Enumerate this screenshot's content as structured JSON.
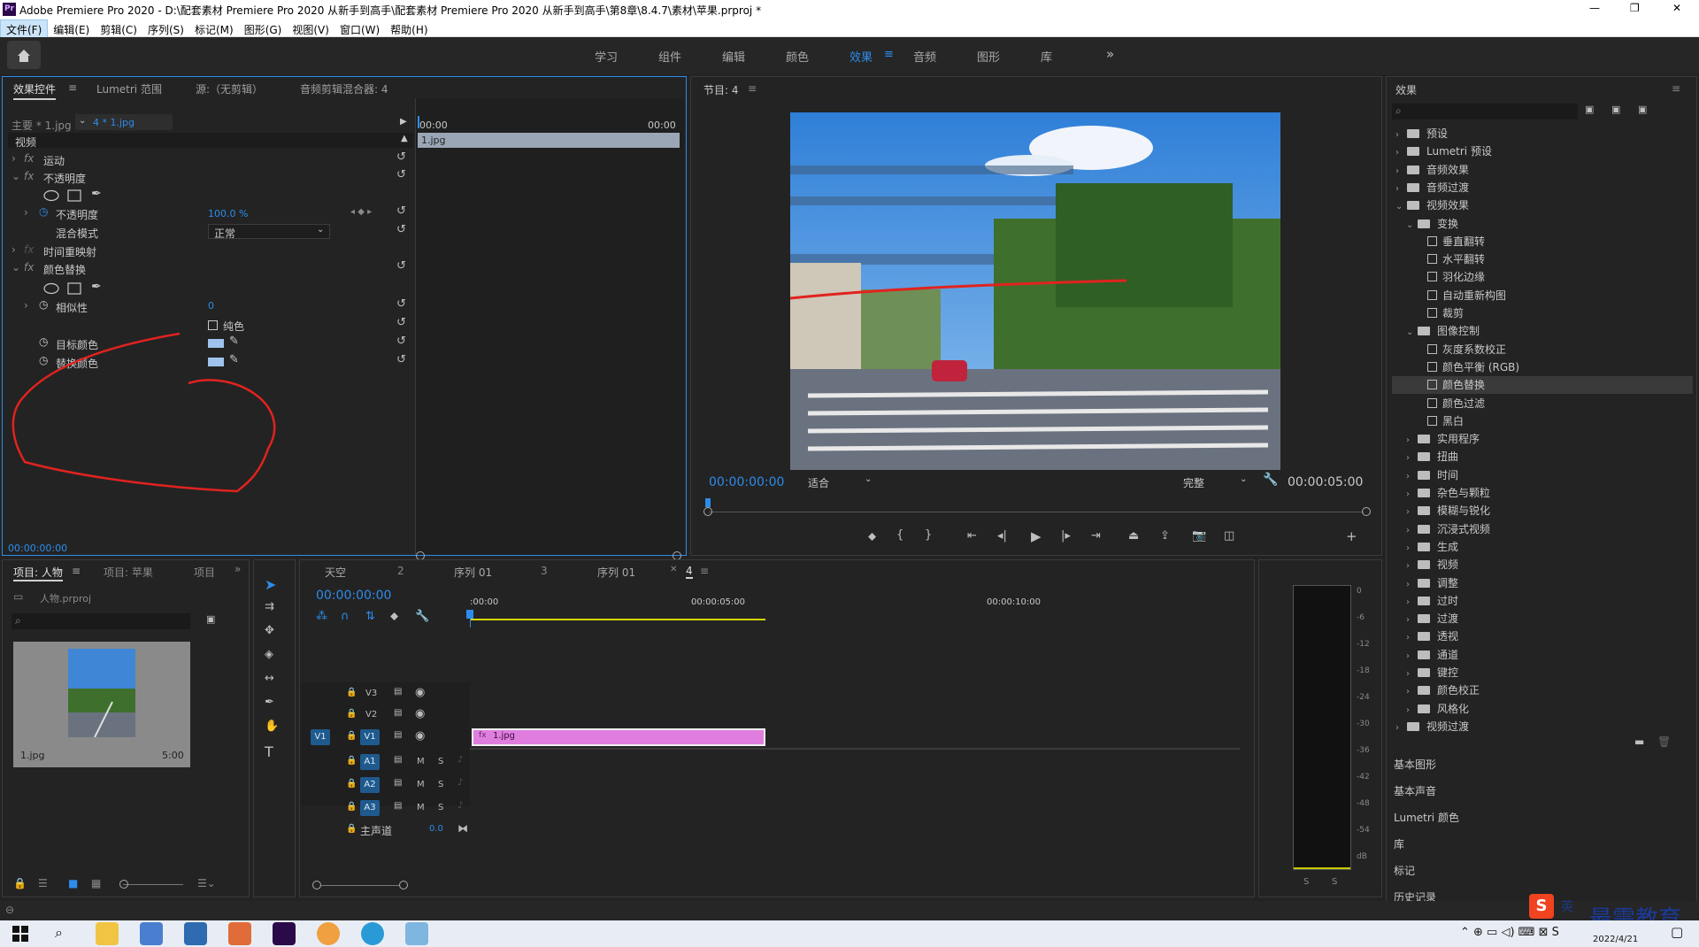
{
  "window": {
    "title": "Adobe Premiere Pro 2020 - D:\\配套素材 Premiere Pro 2020 从新手到高手\\配套素材 Premiere Pro 2020 从新手到高手\\第8章\\8.4.7\\素材\\苹果.prproj *",
    "app_badge": "Pr",
    "controls": [
      "—",
      "❐",
      "✕"
    ]
  },
  "menu": [
    "文件(F)",
    "编辑(E)",
    "剪辑(C)",
    "序列(S)",
    "标记(M)",
    "图形(G)",
    "视图(V)",
    "窗口(W)",
    "帮助(H)"
  ],
  "workspaces": [
    "学习",
    "组件",
    "编辑",
    "颜色",
    "效果",
    "音频",
    "图形",
    "库"
  ],
  "active_workspace": "效果",
  "effect_controls": {
    "tabs": [
      "效果控件",
      "Lumetri 范围",
      "源:（无剪辑）",
      "音频剪辑混合器: 4"
    ],
    "master": "主要 * 1.jpg",
    "clip": "4 * 1.jpg",
    "time_start": "00:00",
    "time_end": "00:00",
    "clip_label": "1.jpg",
    "section": "视频",
    "rows": {
      "motion": "运动",
      "opacity": "不透明度",
      "opacity_prop": "不透明度",
      "opacity_val": "100.0 %",
      "blend": "混合模式",
      "blend_val": "正常",
      "timeremap": "时间重映射",
      "colorreplace": "颜色替换",
      "similarity": "相似性",
      "similarity_val": "0",
      "solid": "纯色",
      "target": "目标颜色",
      "replace": "替换颜色"
    },
    "timecode": "00:00:00:00"
  },
  "program": {
    "title": "节目: 4",
    "timecode": "00:00:00:00",
    "fit": "适合",
    "quality": "完整",
    "duration": "00:00:05:00"
  },
  "effects_panel": {
    "title": "效果",
    "items": [
      {
        "label": "预设",
        "level": 0,
        "type": "folder",
        "open": false
      },
      {
        "label": "Lumetri 预设",
        "level": 0,
        "type": "folder",
        "open": false
      },
      {
        "label": "音频效果",
        "level": 0,
        "type": "folder",
        "open": false
      },
      {
        "label": "音频过渡",
        "level": 0,
        "type": "folder",
        "open": false
      },
      {
        "label": "视频效果",
        "level": 0,
        "type": "folder",
        "open": true
      },
      {
        "label": "变换",
        "level": 1,
        "type": "folder",
        "open": true
      },
      {
        "label": "垂直翻转",
        "level": 2,
        "type": "fx"
      },
      {
        "label": "水平翻转",
        "level": 2,
        "type": "fx"
      },
      {
        "label": "羽化边缘",
        "level": 2,
        "type": "fx"
      },
      {
        "label": "自动重新构图",
        "level": 2,
        "type": "fx"
      },
      {
        "label": "裁剪",
        "level": 2,
        "type": "fx"
      },
      {
        "label": "图像控制",
        "level": 1,
        "type": "folder",
        "open": true
      },
      {
        "label": "灰度系数校正",
        "level": 2,
        "type": "fx"
      },
      {
        "label": "颜色平衡 (RGB)",
        "level": 2,
        "type": "fx"
      },
      {
        "label": "颜色替换",
        "level": 2,
        "type": "fx",
        "selected": true
      },
      {
        "label": "颜色过滤",
        "level": 2,
        "type": "fx"
      },
      {
        "label": "黑白",
        "level": 2,
        "type": "fx"
      },
      {
        "label": "实用程序",
        "level": 1,
        "type": "folder",
        "open": false
      },
      {
        "label": "扭曲",
        "level": 1,
        "type": "folder",
        "open": false
      },
      {
        "label": "时间",
        "level": 1,
        "type": "folder",
        "open": false
      },
      {
        "label": "杂色与颗粒",
        "level": 1,
        "type": "folder",
        "open": false
      },
      {
        "label": "模糊与锐化",
        "level": 1,
        "type": "folder",
        "open": false
      },
      {
        "label": "沉浸式视频",
        "level": 1,
        "type": "folder",
        "open": false
      },
      {
        "label": "生成",
        "level": 1,
        "type": "folder",
        "open": false
      },
      {
        "label": "视频",
        "level": 1,
        "type": "folder",
        "open": false
      },
      {
        "label": "调整",
        "level": 1,
        "type": "folder",
        "open": false
      },
      {
        "label": "过时",
        "level": 1,
        "type": "folder",
        "open": false
      },
      {
        "label": "过渡",
        "level": 1,
        "type": "folder",
        "open": false
      },
      {
        "label": "透视",
        "level": 1,
        "type": "folder",
        "open": false
      },
      {
        "label": "通道",
        "level": 1,
        "type": "folder",
        "open": false
      },
      {
        "label": "键控",
        "level": 1,
        "type": "folder",
        "open": false
      },
      {
        "label": "颜色校正",
        "level": 1,
        "type": "folder",
        "open": false
      },
      {
        "label": "风格化",
        "level": 1,
        "type": "folder",
        "open": false
      },
      {
        "label": "视频过渡",
        "level": 0,
        "type": "folder",
        "open": false
      }
    ],
    "extra_panels": [
      "基本图形",
      "基本声音",
      "Lumetri 颜色",
      "库",
      "标记",
      "历史记录"
    ]
  },
  "project": {
    "tabs": [
      "项目: 人物",
      "项目: 苹果",
      "项目"
    ],
    "file": "人物.prproj",
    "thumb_name": "1.jpg",
    "thumb_dur": "5:00"
  },
  "timeline": {
    "tabs": [
      "天空",
      "2",
      "序列 01",
      "3",
      "序列 01",
      "4"
    ],
    "timecode": "00:00:00:00",
    "ruler": [
      ":00:00",
      "00:00:05:00",
      "00:00:10:00"
    ],
    "video_tracks": [
      "V3",
      "V2",
      "V1"
    ],
    "audio_tracks": [
      "A1",
      "A2",
      "A3"
    ],
    "source_patch": "V1",
    "master": "主声道",
    "master_val": "0.0",
    "clip": "1.jpg"
  },
  "meter": {
    "scale": [
      "0",
      "-6",
      "-12",
      "-18",
      "-24",
      "-30",
      "-36",
      "-42",
      "-48",
      "-54",
      "dB"
    ],
    "solo": [
      "S",
      "S"
    ]
  },
  "watermark": {
    "text": "最需教育",
    "ime": "英"
  },
  "taskbar": {
    "date": "2022/4/21"
  }
}
